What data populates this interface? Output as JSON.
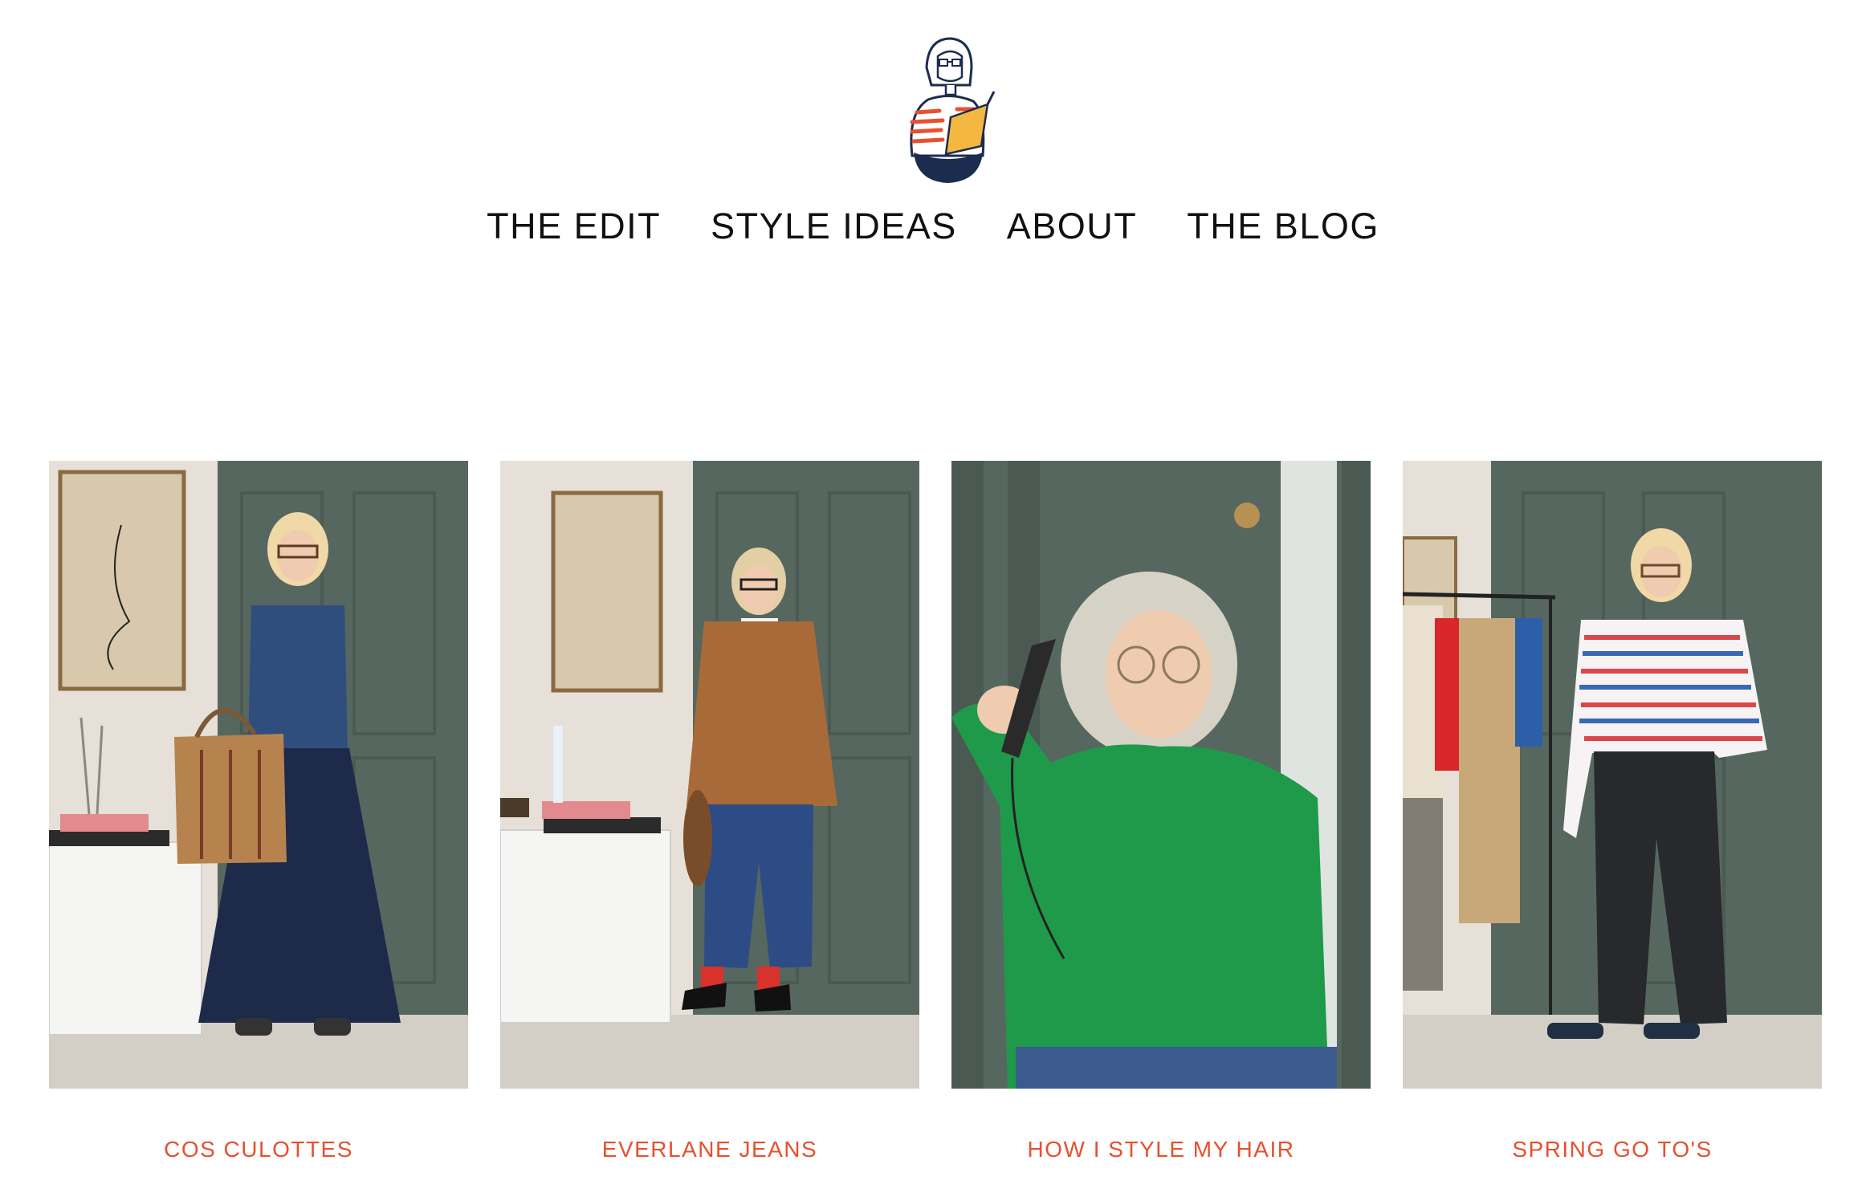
{
  "colors": {
    "caption": "#e8502e",
    "nav_text": "#111111",
    "wall_green": "#56675f",
    "background": "#ffffff"
  },
  "header": {
    "logo_icon": "illustrated-woman-reading-logo-icon"
  },
  "nav": {
    "items": [
      {
        "label": "THE EDIT"
      },
      {
        "label": "STYLE IDEAS"
      },
      {
        "label": "ABOUT"
      },
      {
        "label": "THE BLOG"
      }
    ]
  },
  "posts": [
    {
      "caption": "COS CULOTTES"
    },
    {
      "caption": "EVERLANE JEANS"
    },
    {
      "caption": "HOW I STYLE MY HAIR"
    },
    {
      "caption": "SPRING GO TO'S"
    }
  ]
}
